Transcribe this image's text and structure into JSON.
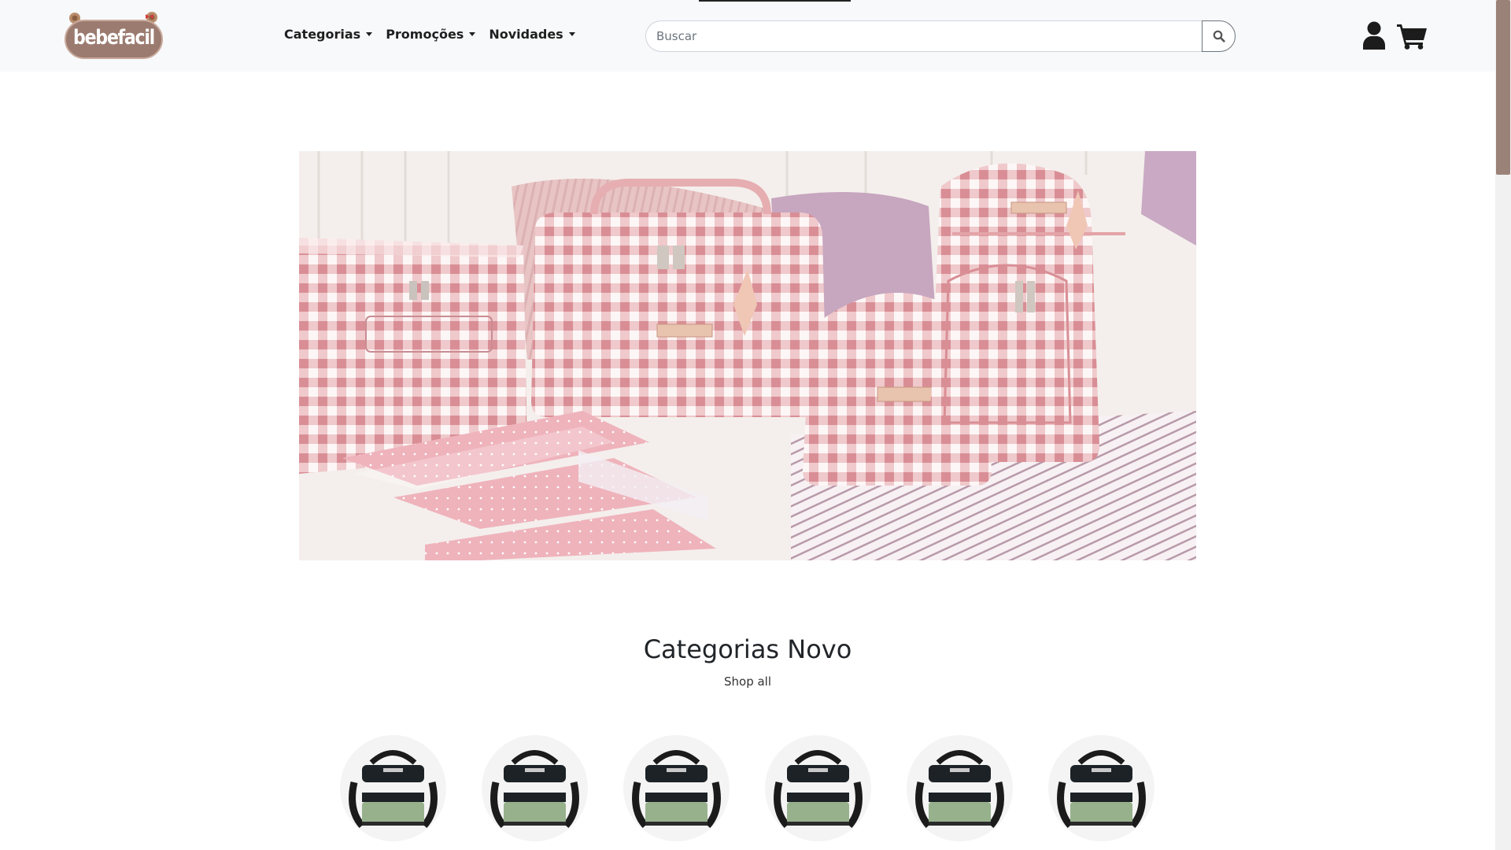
{
  "header": {
    "logo_text": "bebefacil",
    "nav": [
      {
        "label": "Categorias"
      },
      {
        "label": "Promoções"
      },
      {
        "label": "Novidades"
      }
    ],
    "search": {
      "placeholder": "Buscar",
      "value": ""
    },
    "icons": {
      "search": "search-icon",
      "user": "user-icon",
      "cart": "shopping-cart-icon"
    }
  },
  "hero": {
    "image": "pink-gingham-baby-bags-banner"
  },
  "categories": {
    "title": "Categorias Novo",
    "shop_all": "Shop all",
    "items": [
      {
        "image": "green-striped-lunch-bag"
      },
      {
        "image": "green-striped-lunch-bag"
      },
      {
        "image": "green-striped-lunch-bag"
      },
      {
        "image": "green-striped-lunch-bag"
      },
      {
        "image": "green-striped-lunch-bag"
      },
      {
        "image": "green-striped-lunch-bag"
      }
    ]
  },
  "colors": {
    "brand": "#9b7b70",
    "header_bg": "#f8f9fa",
    "text": "#212529",
    "accent_pink": "#e6a9b0"
  }
}
